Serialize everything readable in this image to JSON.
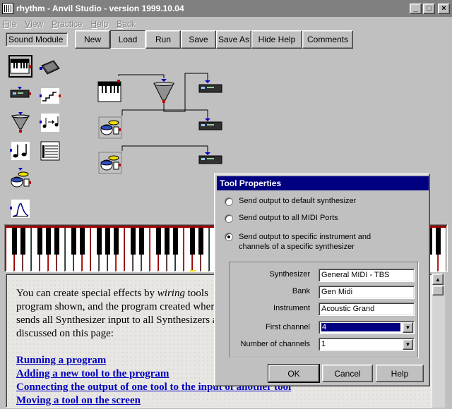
{
  "window": {
    "title": "rhythm - Anvil Studio - version 1999.10.04"
  },
  "titlebar_buttons": [
    "_",
    "□",
    "×"
  ],
  "menu": [
    {
      "pre": "",
      "key": "F",
      "post": "ile"
    },
    {
      "pre": "",
      "key": "V",
      "post": "iew"
    },
    {
      "pre": "",
      "key": "P",
      "post": "ractice"
    },
    {
      "pre": "",
      "key": "H",
      "post": "elp"
    },
    {
      "pre": "",
      "key": "B",
      "post": "ack"
    }
  ],
  "palette": {
    "label": "Sound Module",
    "tools": [
      {
        "icon": "keyboard-icon",
        "active": true
      },
      {
        "icon": "sequencer-icon",
        "active": false
      },
      {
        "icon": "synth-module-icon",
        "active": false
      },
      {
        "icon": "stairs-icon",
        "active": false
      },
      {
        "icon": "funnel-icon",
        "active": false
      },
      {
        "icon": "note-arrow-icon",
        "active": false
      },
      {
        "icon": "notes-icon",
        "active": false
      },
      {
        "icon": "staff-icon",
        "active": false
      },
      {
        "icon": "drums-icon",
        "active": false
      },
      {
        "icon": "envelope-icon",
        "active": false
      }
    ]
  },
  "toolbar": {
    "buttons": [
      {
        "label": "New",
        "pressed": false
      },
      {
        "label": "Load",
        "pressed": true
      },
      {
        "label": "Run",
        "pressed": false
      },
      {
        "label": "Save",
        "pressed": false
      },
      {
        "label": "Save As",
        "pressed": false
      },
      {
        "label": "Hide Help",
        "pressed": false
      },
      {
        "label": "Comments",
        "pressed": false
      }
    ]
  },
  "help": {
    "line1_pre": "You can create special effects by ",
    "line1_em": "wiring",
    "line1_post": " tools",
    "line2": "program shown, and the program created wher",
    "line3": "sends all Synthesizer input to all Synthesizers ar",
    "line4": "discussed on this page:",
    "links": [
      "Running a program",
      "Adding a new tool to the program",
      "Connecting the output of one tool to the input of another tool",
      "Moving a tool on the screen"
    ]
  },
  "dialog": {
    "title": "Tool Properties",
    "options": [
      {
        "label": "Send output to default synthesizer",
        "checked": false
      },
      {
        "label": "Send output to all MIDI Ports",
        "checked": false
      },
      {
        "label": "Send output to specific instrument and channels of a specific synthesizer",
        "checked": true
      }
    ],
    "fields": {
      "synthesizer": {
        "label": "Synthesizer",
        "value": "General MIDI - TBS"
      },
      "bank": {
        "label": "Bank",
        "value": "Gen Midi"
      },
      "instrument": {
        "label": "Instrument",
        "value": "Acoustic Grand"
      },
      "first_channel": {
        "label": "First channel",
        "value": "4"
      },
      "num_channels": {
        "label": "Number of channels",
        "value": "1"
      }
    },
    "buttons": {
      "ok": "OK",
      "cancel": "Cancel",
      "help": "Help"
    }
  },
  "colors": {
    "title_inactive": "#808080",
    "dialog_title": "#000080",
    "link": "#0000c0",
    "keyboard_frame": "#a00000",
    "face": "#c0c0c0"
  }
}
